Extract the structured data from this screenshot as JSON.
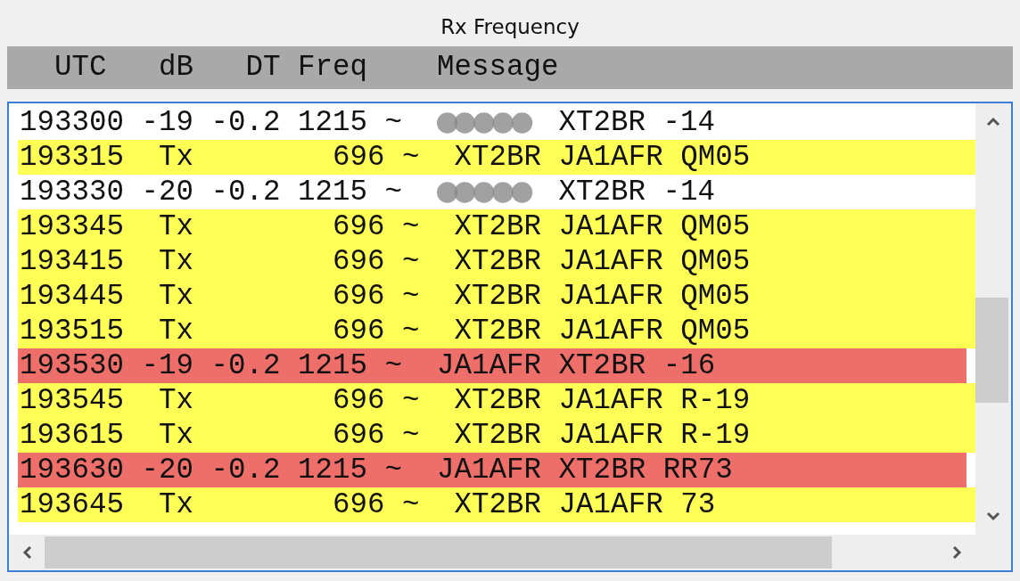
{
  "title": "Rx Frequency",
  "header": "  UTC   dB   DT Freq    Message",
  "rows": [
    {
      "kind": "rx",
      "text": "193300 -19 -0.2 1215 ~",
      "redacted": true,
      "message": "XT2BR -14"
    },
    {
      "kind": "tx",
      "text": "193315  Tx        696 ~",
      "redacted": false,
      "message": "XT2BR JA1AFR QM05"
    },
    {
      "kind": "rx",
      "text": "193330 -20 -0.2 1215 ~",
      "redacted": true,
      "message": "XT2BR -14"
    },
    {
      "kind": "tx",
      "text": "193345  Tx        696 ~",
      "redacted": false,
      "message": "XT2BR JA1AFR QM05"
    },
    {
      "kind": "tx",
      "text": "193415  Tx        696 ~",
      "redacted": false,
      "message": "XT2BR JA1AFR QM05"
    },
    {
      "kind": "tx",
      "text": "193445  Tx        696 ~",
      "redacted": false,
      "message": "XT2BR JA1AFR QM05"
    },
    {
      "kind": "tx",
      "text": "193515  Tx        696 ~",
      "redacted": false,
      "message": "XT2BR JA1AFR QM05"
    },
    {
      "kind": "to_me",
      "text": "193530 -19 -0.2 1215 ~",
      "redacted": false,
      "message": "JA1AFR XT2BR -16"
    },
    {
      "kind": "tx",
      "text": "193545  Tx        696 ~",
      "redacted": false,
      "message": "XT2BR JA1AFR R-19"
    },
    {
      "kind": "tx",
      "text": "193615  Tx        696 ~",
      "redacted": false,
      "message": "XT2BR JA1AFR R-19"
    },
    {
      "kind": "to_me",
      "text": "193630 -20 -0.2 1215 ~",
      "redacted": false,
      "message": "JA1AFR XT2BR RR73"
    },
    {
      "kind": "tx",
      "text": "193645  Tx        696 ~",
      "redacted": false,
      "message": "XT2BR JA1AFR 73"
    }
  ]
}
